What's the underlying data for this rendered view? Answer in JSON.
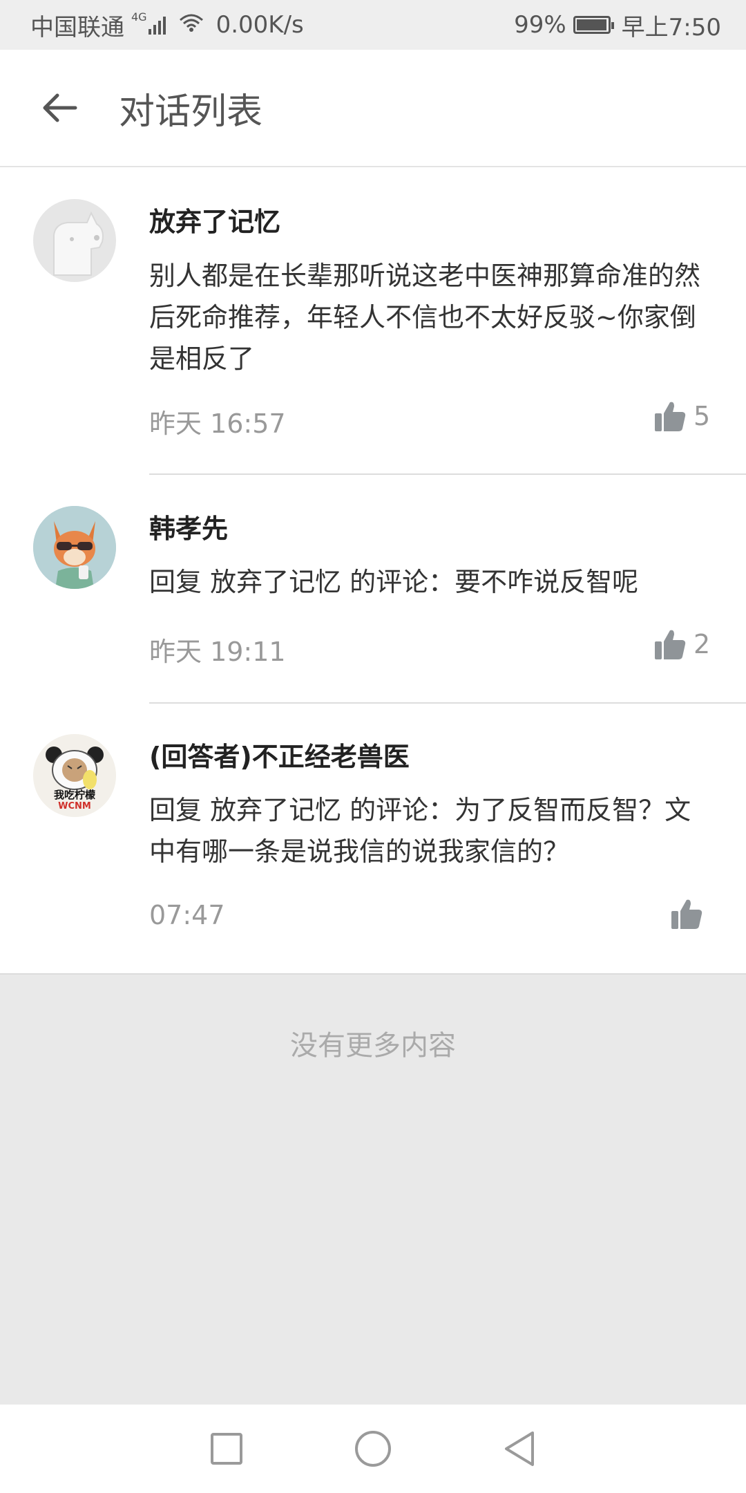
{
  "status_bar": {
    "carrier": "中国联通",
    "network_type": "4G",
    "speed": "0.00K/s",
    "battery": "99%",
    "battery_level": 0.99,
    "time": "早上7:50"
  },
  "header": {
    "title": "对话列表",
    "back_icon": "arrow-left-icon"
  },
  "comments": [
    {
      "user": "放弃了记忆",
      "avatar": "default-dog-avatar",
      "text": "别人都是在长辈那听说这老中医神那算命准的然后死命推荐，年轻人不信也不太好反驳~你家倒是相反了",
      "time": "昨天 16:57",
      "likes": "5"
    },
    {
      "user": "韩孝先",
      "avatar": "fox-with-sunglasses-avatar",
      "text": "回复 放弃了记忆 的评论：要不咋说反智呢",
      "time": "昨天 19:11",
      "likes": "2"
    },
    {
      "user": "(回答者)不正经老兽医",
      "avatar": "panda-meme-avatar",
      "avatar_caption": "我吃柠檬",
      "avatar_caption_sub": "WCNM",
      "text": "回复 放弃了记忆 的评论：为了反智而反智？文中有哪一条是说我信的说我家信的？",
      "time": "07:47",
      "likes": ""
    }
  ],
  "footer": {
    "no_more": "没有更多内容"
  },
  "nav_bar": {
    "icons": [
      "square-recents-icon",
      "circle-home-icon",
      "triangle-back-icon"
    ]
  },
  "colors": {
    "background": "#e9e9e9",
    "card": "#ffffff",
    "muted_text": "#999999",
    "like_icon": "#8f9498"
  }
}
